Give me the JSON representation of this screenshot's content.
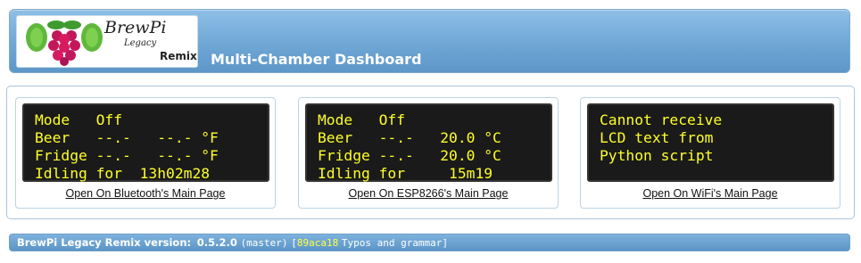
{
  "header": {
    "logo": {
      "brand": "BrewPi",
      "sub": "Legacy",
      "remix": "Remix"
    },
    "title": "Multi-Chamber Dashboard"
  },
  "chambers": [
    {
      "lcd": [
        "Mode   Off",
        "Beer   --.-   --.- °F",
        "Fridge --.-   --.- °F",
        "Idling for  13h02m28"
      ],
      "link": "Open On Bluetooth's Main Page"
    },
    {
      "lcd": [
        "Mode   Off",
        "Beer   --.-   20.0 °C",
        "Fridge --.-   20.0 °C",
        "Idling for     15m19"
      ],
      "link": "Open On ESP8266's Main Page"
    },
    {
      "lcd": [
        "Cannot receive",
        "LCD text from",
        "Python script",
        ""
      ],
      "link": "Open On WiFi's Main Page"
    }
  ],
  "footer": {
    "label": "BrewPi Legacy Remix version:",
    "version": "0.5.2.0",
    "branch": "(master)",
    "bracket_open": "[",
    "commit": "89aca18",
    "message": "Typos and grammar",
    "bracket_close": "]"
  },
  "colors": {
    "header_bg": "#6fa7d6",
    "lcd_bg": "#1a1a1a",
    "lcd_text": "#ffff28",
    "commit_hash": "#ffff40"
  }
}
